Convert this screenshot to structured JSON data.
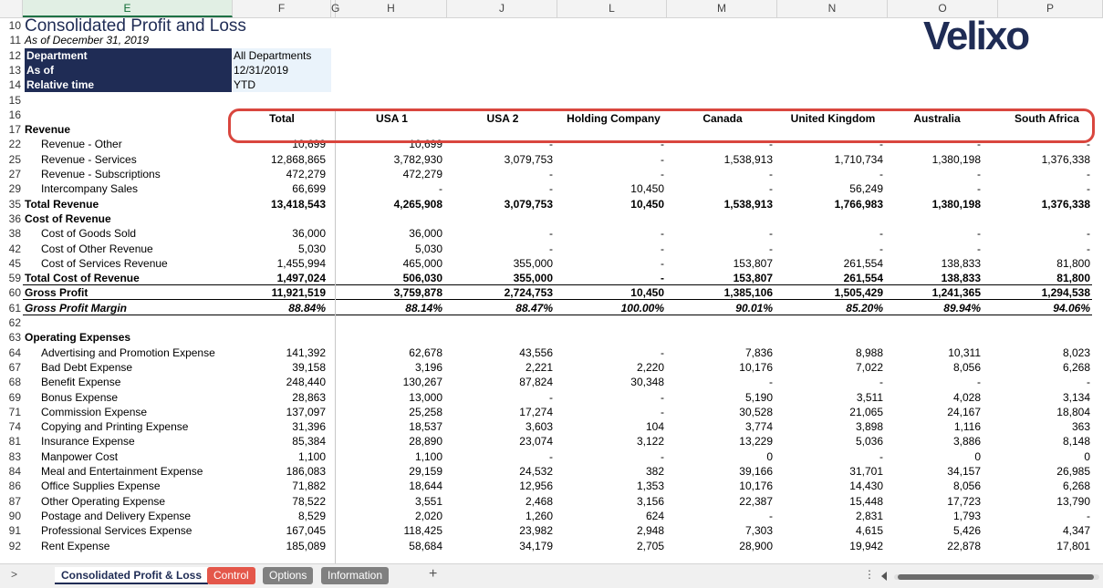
{
  "columns": [
    "E",
    "F",
    "G",
    "H",
    "J",
    "L",
    "M",
    "N",
    "O",
    "P"
  ],
  "report": {
    "title": "Consolidated Profit and Loss",
    "as_of_line": "As of December 31, 2019",
    "params": [
      {
        "row": "12",
        "label": "Department",
        "value": "All Departments"
      },
      {
        "row": "13",
        "label": "As of",
        "value": "12/31/2019"
      },
      {
        "row": "14",
        "label": "Relative time",
        "value": "YTD"
      }
    ]
  },
  "logo": "Velixo",
  "header_row": {
    "row_numbers": [
      "15",
      "16"
    ],
    "labels": [
      "Total",
      "USA 1",
      "USA 2",
      "Holding Company",
      "Canada",
      "United Kingdom",
      "Australia",
      "South Africa"
    ]
  },
  "rows": [
    {
      "row": "17",
      "label": "Revenue",
      "style": "section",
      "values": [
        "",
        "",
        "",
        "",
        "",
        "",
        "",
        ""
      ]
    },
    {
      "row": "22",
      "label": "Revenue - Other",
      "style": "item",
      "values": [
        "10,699",
        "10,699",
        "-",
        "-",
        "-",
        "-",
        "-",
        "-"
      ]
    },
    {
      "row": "25",
      "label": "Revenue - Services",
      "style": "item",
      "values": [
        "12,868,865",
        "3,782,930",
        "3,079,753",
        "-",
        "1,538,913",
        "1,710,734",
        "1,380,198",
        "1,376,338"
      ]
    },
    {
      "row": "27",
      "label": "Revenue - Subscriptions",
      "style": "item",
      "values": [
        "472,279",
        "472,279",
        "-",
        "-",
        "-",
        "-",
        "-",
        "-"
      ]
    },
    {
      "row": "29",
      "label": "Intercompany Sales",
      "style": "item",
      "values": [
        "66,699",
        "-",
        "-",
        "10,450",
        "-",
        "56,249",
        "-",
        "-"
      ]
    },
    {
      "row": "35",
      "label": "Total Revenue",
      "style": "total",
      "values": [
        "13,418,543",
        "4,265,908",
        "3,079,753",
        "10,450",
        "1,538,913",
        "1,766,983",
        "1,380,198",
        "1,376,338"
      ]
    },
    {
      "row": "36",
      "label": "Cost of Revenue",
      "style": "section",
      "values": [
        "",
        "",
        "",
        "",
        "",
        "",
        "",
        ""
      ]
    },
    {
      "row": "38",
      "label": "Cost of Goods Sold",
      "style": "item",
      "values": [
        "36,000",
        "36,000",
        "-",
        "-",
        "-",
        "-",
        "-",
        "-"
      ]
    },
    {
      "row": "42",
      "label": "Cost of Other Revenue",
      "style": "item",
      "values": [
        "5,030",
        "5,030",
        "-",
        "-",
        "-",
        "-",
        "-",
        "-"
      ]
    },
    {
      "row": "45",
      "label": "Cost of Services Revenue",
      "style": "item",
      "values": [
        "1,455,994",
        "465,000",
        "355,000",
        "-",
        "153,807",
        "261,554",
        "138,833",
        "81,800"
      ]
    },
    {
      "row": "59",
      "label": "Total Cost of Revenue",
      "style": "total-under",
      "values": [
        "1,497,024",
        "506,030",
        "355,000",
        "-",
        "153,807",
        "261,554",
        "138,833",
        "81,800"
      ]
    },
    {
      "row": "60",
      "label": "Gross Profit",
      "style": "gross",
      "values": [
        "11,921,519",
        "3,759,878",
        "2,724,753",
        "10,450",
        "1,385,106",
        "1,505,429",
        "1,241,365",
        "1,294,538"
      ]
    },
    {
      "row": "61",
      "label": "Gross Profit Margin",
      "style": "margin",
      "values": [
        "88.84%",
        "88.14%",
        "88.47%",
        "100.00%",
        "90.01%",
        "85.20%",
        "89.94%",
        "94.06%"
      ]
    },
    {
      "row": "62",
      "label": "",
      "style": "blank",
      "values": [
        "",
        "",
        "",
        "",
        "",
        "",
        "",
        ""
      ]
    },
    {
      "row": "63",
      "label": "Operating Expenses",
      "style": "section",
      "values": [
        "",
        "",
        "",
        "",
        "",
        "",
        "",
        ""
      ]
    },
    {
      "row": "64",
      "label": "Advertising and Promotion Expense",
      "style": "item",
      "values": [
        "141,392",
        "62,678",
        "43,556",
        "-",
        "7,836",
        "8,988",
        "10,311",
        "8,023"
      ]
    },
    {
      "row": "67",
      "label": "Bad Debt Expense",
      "style": "item",
      "values": [
        "39,158",
        "3,196",
        "2,221",
        "2,220",
        "10,176",
        "7,022",
        "8,056",
        "6,268"
      ]
    },
    {
      "row": "68",
      "label": "Benefit Expense",
      "style": "item",
      "values": [
        "248,440",
        "130,267",
        "87,824",
        "30,348",
        "-",
        "-",
        "-",
        "-"
      ]
    },
    {
      "row": "69",
      "label": "Bonus Expense",
      "style": "item",
      "values": [
        "28,863",
        "13,000",
        "-",
        "-",
        "5,190",
        "3,511",
        "4,028",
        "3,134"
      ]
    },
    {
      "row": "71",
      "label": "Commission Expense",
      "style": "item",
      "values": [
        "137,097",
        "25,258",
        "17,274",
        "-",
        "30,528",
        "21,065",
        "24,167",
        "18,804"
      ]
    },
    {
      "row": "74",
      "label": "Copying and Printing Expense",
      "style": "item",
      "values": [
        "31,396",
        "18,537",
        "3,603",
        "104",
        "3,774",
        "3,898",
        "1,116",
        "363"
      ]
    },
    {
      "row": "81",
      "label": "Insurance Expense",
      "style": "item",
      "values": [
        "85,384",
        "28,890",
        "23,074",
        "3,122",
        "13,229",
        "5,036",
        "3,886",
        "8,148"
      ]
    },
    {
      "row": "83",
      "label": "Manpower Cost",
      "style": "item",
      "values": [
        "1,100",
        "1,100",
        "-",
        "-",
        "0",
        "-",
        "0",
        "0"
      ]
    },
    {
      "row": "84",
      "label": "Meal and Entertainment Expense",
      "style": "item",
      "values": [
        "186,083",
        "29,159",
        "24,532",
        "382",
        "39,166",
        "31,701",
        "34,157",
        "26,985"
      ]
    },
    {
      "row": "86",
      "label": "Office Supplies Expense",
      "style": "item",
      "values": [
        "71,882",
        "18,644",
        "12,956",
        "1,353",
        "10,176",
        "14,430",
        "8,056",
        "6,268"
      ]
    },
    {
      "row": "87",
      "label": "Other Operating Expense",
      "style": "item",
      "values": [
        "78,522",
        "3,551",
        "2,468",
        "3,156",
        "22,387",
        "15,448",
        "17,723",
        "13,790"
      ]
    },
    {
      "row": "90",
      "label": "Postage and Delivery Expense",
      "style": "item",
      "values": [
        "8,529",
        "2,020",
        "1,260",
        "624",
        "-",
        "2,831",
        "1,793",
        "-"
      ]
    },
    {
      "row": "91",
      "label": "Professional Services Expense",
      "style": "item",
      "values": [
        "167,045",
        "118,425",
        "23,982",
        "2,948",
        "7,303",
        "4,615",
        "5,426",
        "4,347"
      ]
    },
    {
      "row": "92",
      "label": "Rent Expense",
      "style": "item",
      "values": [
        "185,089",
        "58,684",
        "34,179",
        "2,705",
        "28,900",
        "19,942",
        "22,878",
        "17,801"
      ]
    }
  ],
  "tabs": [
    {
      "label": "Consolidated Profit & Loss",
      "active": true,
      "color": "#dfe9f7"
    },
    {
      "label": "Control",
      "active": false,
      "color": "#e4574a"
    },
    {
      "label": "Options",
      "active": false,
      "color": "#808080"
    },
    {
      "label": "Information",
      "active": false,
      "color": "#808080"
    }
  ],
  "add_sheet_glyph": "+",
  "nav_glyph": ">",
  "more_glyph": "⋮",
  "colors": {
    "navy": "#1f2c55",
    "highlight": "#d9463e",
    "param_bg": "#eaf3fb"
  }
}
